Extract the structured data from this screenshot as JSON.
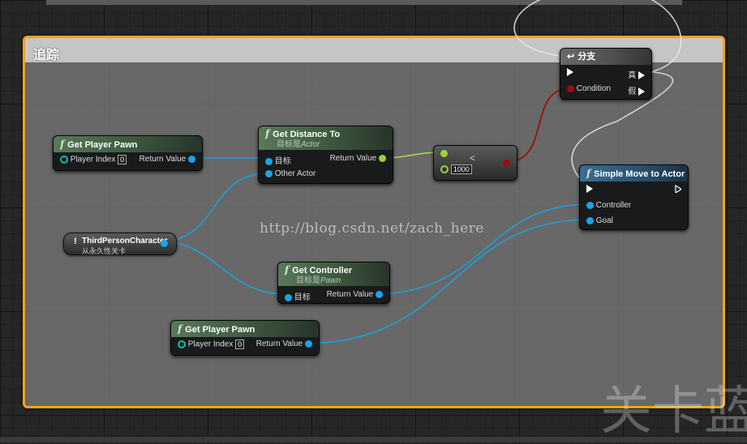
{
  "comment": {
    "title": "追踪"
  },
  "watermark": "http://blog.csdn.net/zach_here",
  "corner_mark": "关卡蓝",
  "nodes": {
    "get_player_pawn_1": {
      "title": "Get Player Pawn",
      "index_label": "Player Index",
      "index_value": "0",
      "return_label": "Return Value"
    },
    "get_distance_to": {
      "title": "Get Distance To",
      "subtitle_prefix": "目标是",
      "subtitle_target": "Actor",
      "target_label": "目标",
      "other_label": "Other Actor",
      "return_label": "Return Value"
    },
    "compare": {
      "op": "<",
      "value": "1000"
    },
    "branch": {
      "title": "分支",
      "condition_label": "Condition",
      "true_label": "真",
      "false_label": "假"
    },
    "simple_move": {
      "title": "Simple Move to Actor",
      "controller_label": "Controller",
      "goal_label": "Goal"
    },
    "third_person": {
      "title": "ThirdPersonCharacter",
      "subtitle": "从永久性关卡"
    },
    "get_controller": {
      "title": "Get Controller",
      "subtitle_prefix": "目标是",
      "subtitle_target": "Pawn",
      "target_label": "目标",
      "return_label": "Return Value"
    },
    "get_player_pawn_2": {
      "title": "Get Player Pawn",
      "index_label": "Player Index",
      "index_value": "0",
      "return_label": "Return Value"
    }
  },
  "colors": {
    "comment_border": "#f0a31c",
    "object_pin": "#15a7e8",
    "float_pin": "#9bd33b",
    "bool_pin": "#9b0d0d",
    "exec_pin": "#ffffff"
  },
  "icons": [
    "function-icon",
    "branch-icon",
    "exec-pin-icon",
    "object-pin-icon",
    "variable-icon"
  ]
}
